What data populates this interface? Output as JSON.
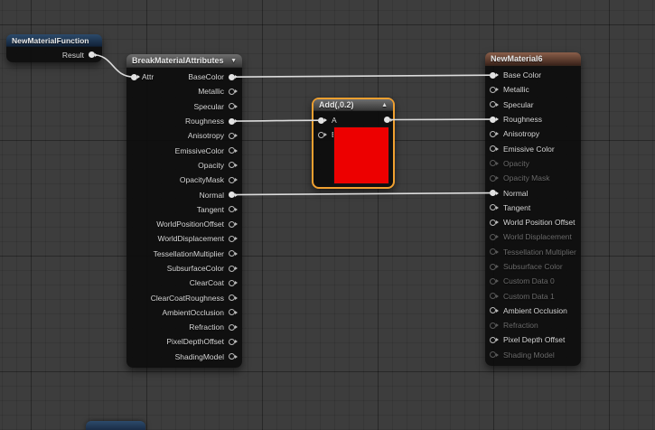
{
  "canvas": {
    "background": "#3d3d3d"
  },
  "colors": {
    "wire": "#dcdcdc",
    "selection_border": "#f0a030",
    "preview_color": "#ed0000"
  },
  "nodes": {
    "material_function": {
      "title": "NewMaterialFunction",
      "output_label": "Result"
    },
    "break": {
      "title": "BreakMaterialAttributes",
      "collapse_icon": "▼",
      "input_label": "Attr",
      "outputs": [
        {
          "label": "BaseColor",
          "pin": "break.BaseColor",
          "connected": true
        },
        {
          "label": "Metallic",
          "pin": "break.Metallic"
        },
        {
          "label": "Specular",
          "pin": "break.Specular"
        },
        {
          "label": "Roughness",
          "pin": "break.Roughness",
          "connected": true
        },
        {
          "label": "Anisotropy",
          "pin": "break.Anisotropy"
        },
        {
          "label": "EmissiveColor",
          "pin": "break.EmissiveColor"
        },
        {
          "label": "Opacity",
          "pin": "break.Opacity"
        },
        {
          "label": "OpacityMask",
          "pin": "break.OpacityMask"
        },
        {
          "label": "Normal",
          "pin": "break.Normal",
          "connected": true
        },
        {
          "label": "Tangent",
          "pin": "break.Tangent"
        },
        {
          "label": "WorldPositionOffset",
          "pin": "break.WorldPositionOffset"
        },
        {
          "label": "WorldDisplacement",
          "pin": "break.WorldDisplacement"
        },
        {
          "label": "TessellationMultiplier",
          "pin": "break.TessellationMultiplier"
        },
        {
          "label": "SubsurfaceColor",
          "pin": "break.SubsurfaceColor"
        },
        {
          "label": "ClearCoat",
          "pin": "break.ClearCoat"
        },
        {
          "label": "ClearCoatRoughness",
          "pin": "break.ClearCoatRoughness"
        },
        {
          "label": "AmbientOcclusion",
          "pin": "break.AmbientOcclusion"
        },
        {
          "label": "Refraction",
          "pin": "break.Refraction"
        },
        {
          "label": "PixelDepthOffset",
          "pin": "break.PixelDepthOffset"
        },
        {
          "label": "ShadingModel",
          "pin": "break.ShadingModel"
        }
      ]
    },
    "add": {
      "title": "Add(,0.2)",
      "collapse_icon": "▲",
      "input_a": "A",
      "input_b": "B"
    },
    "material": {
      "title": "NewMaterial6",
      "inputs": [
        {
          "label": "Base Color",
          "pin": "mat.BaseColor",
          "connected": true
        },
        {
          "label": "Metallic",
          "pin": "mat.Metallic"
        },
        {
          "label": "Specular",
          "pin": "mat.Specular"
        },
        {
          "label": "Roughness",
          "pin": "mat.Roughness",
          "connected": true
        },
        {
          "label": "Anisotropy",
          "pin": "mat.Anisotropy"
        },
        {
          "label": "Emissive Color",
          "pin": "mat.EmissiveColor"
        },
        {
          "label": "Opacity",
          "pin": "mat.Opacity",
          "disabled": true
        },
        {
          "label": "Opacity Mask",
          "pin": "mat.OpacityMask",
          "disabled": true
        },
        {
          "label": "Normal",
          "pin": "mat.Normal",
          "connected": true
        },
        {
          "label": "Tangent",
          "pin": "mat.Tangent"
        },
        {
          "label": "World Position Offset",
          "pin": "mat.WorldPositionOffset"
        },
        {
          "label": "World Displacement",
          "pin": "mat.WorldDisplacement",
          "disabled": true
        },
        {
          "label": "Tessellation Multiplier",
          "pin": "mat.TessellationMultiplier",
          "disabled": true
        },
        {
          "label": "Subsurface Color",
          "pin": "mat.SubsurfaceColor",
          "disabled": true
        },
        {
          "label": "Custom Data 0",
          "pin": "mat.CustomData0",
          "disabled": true
        },
        {
          "label": "Custom Data 1",
          "pin": "mat.CustomData1",
          "disabled": true
        },
        {
          "label": "Ambient Occlusion",
          "pin": "mat.AmbientOcclusion"
        },
        {
          "label": "Refraction",
          "pin": "mat.Refraction",
          "disabled": true
        },
        {
          "label": "Pixel Depth Offset",
          "pin": "mat.PixelDepthOffset"
        },
        {
          "label": "Shading Model",
          "pin": "mat.ShadingModel",
          "disabled": true
        }
      ]
    }
  },
  "connections": [
    {
      "from": "mf.result",
      "to": "break.attr"
    },
    {
      "from": "break.BaseColor",
      "to": "mat.BaseColor"
    },
    {
      "from": "break.Roughness",
      "to": "add.A"
    },
    {
      "from": "add.out",
      "to": "mat.Roughness"
    },
    {
      "from": "break.Normal",
      "to": "mat.Normal"
    }
  ]
}
